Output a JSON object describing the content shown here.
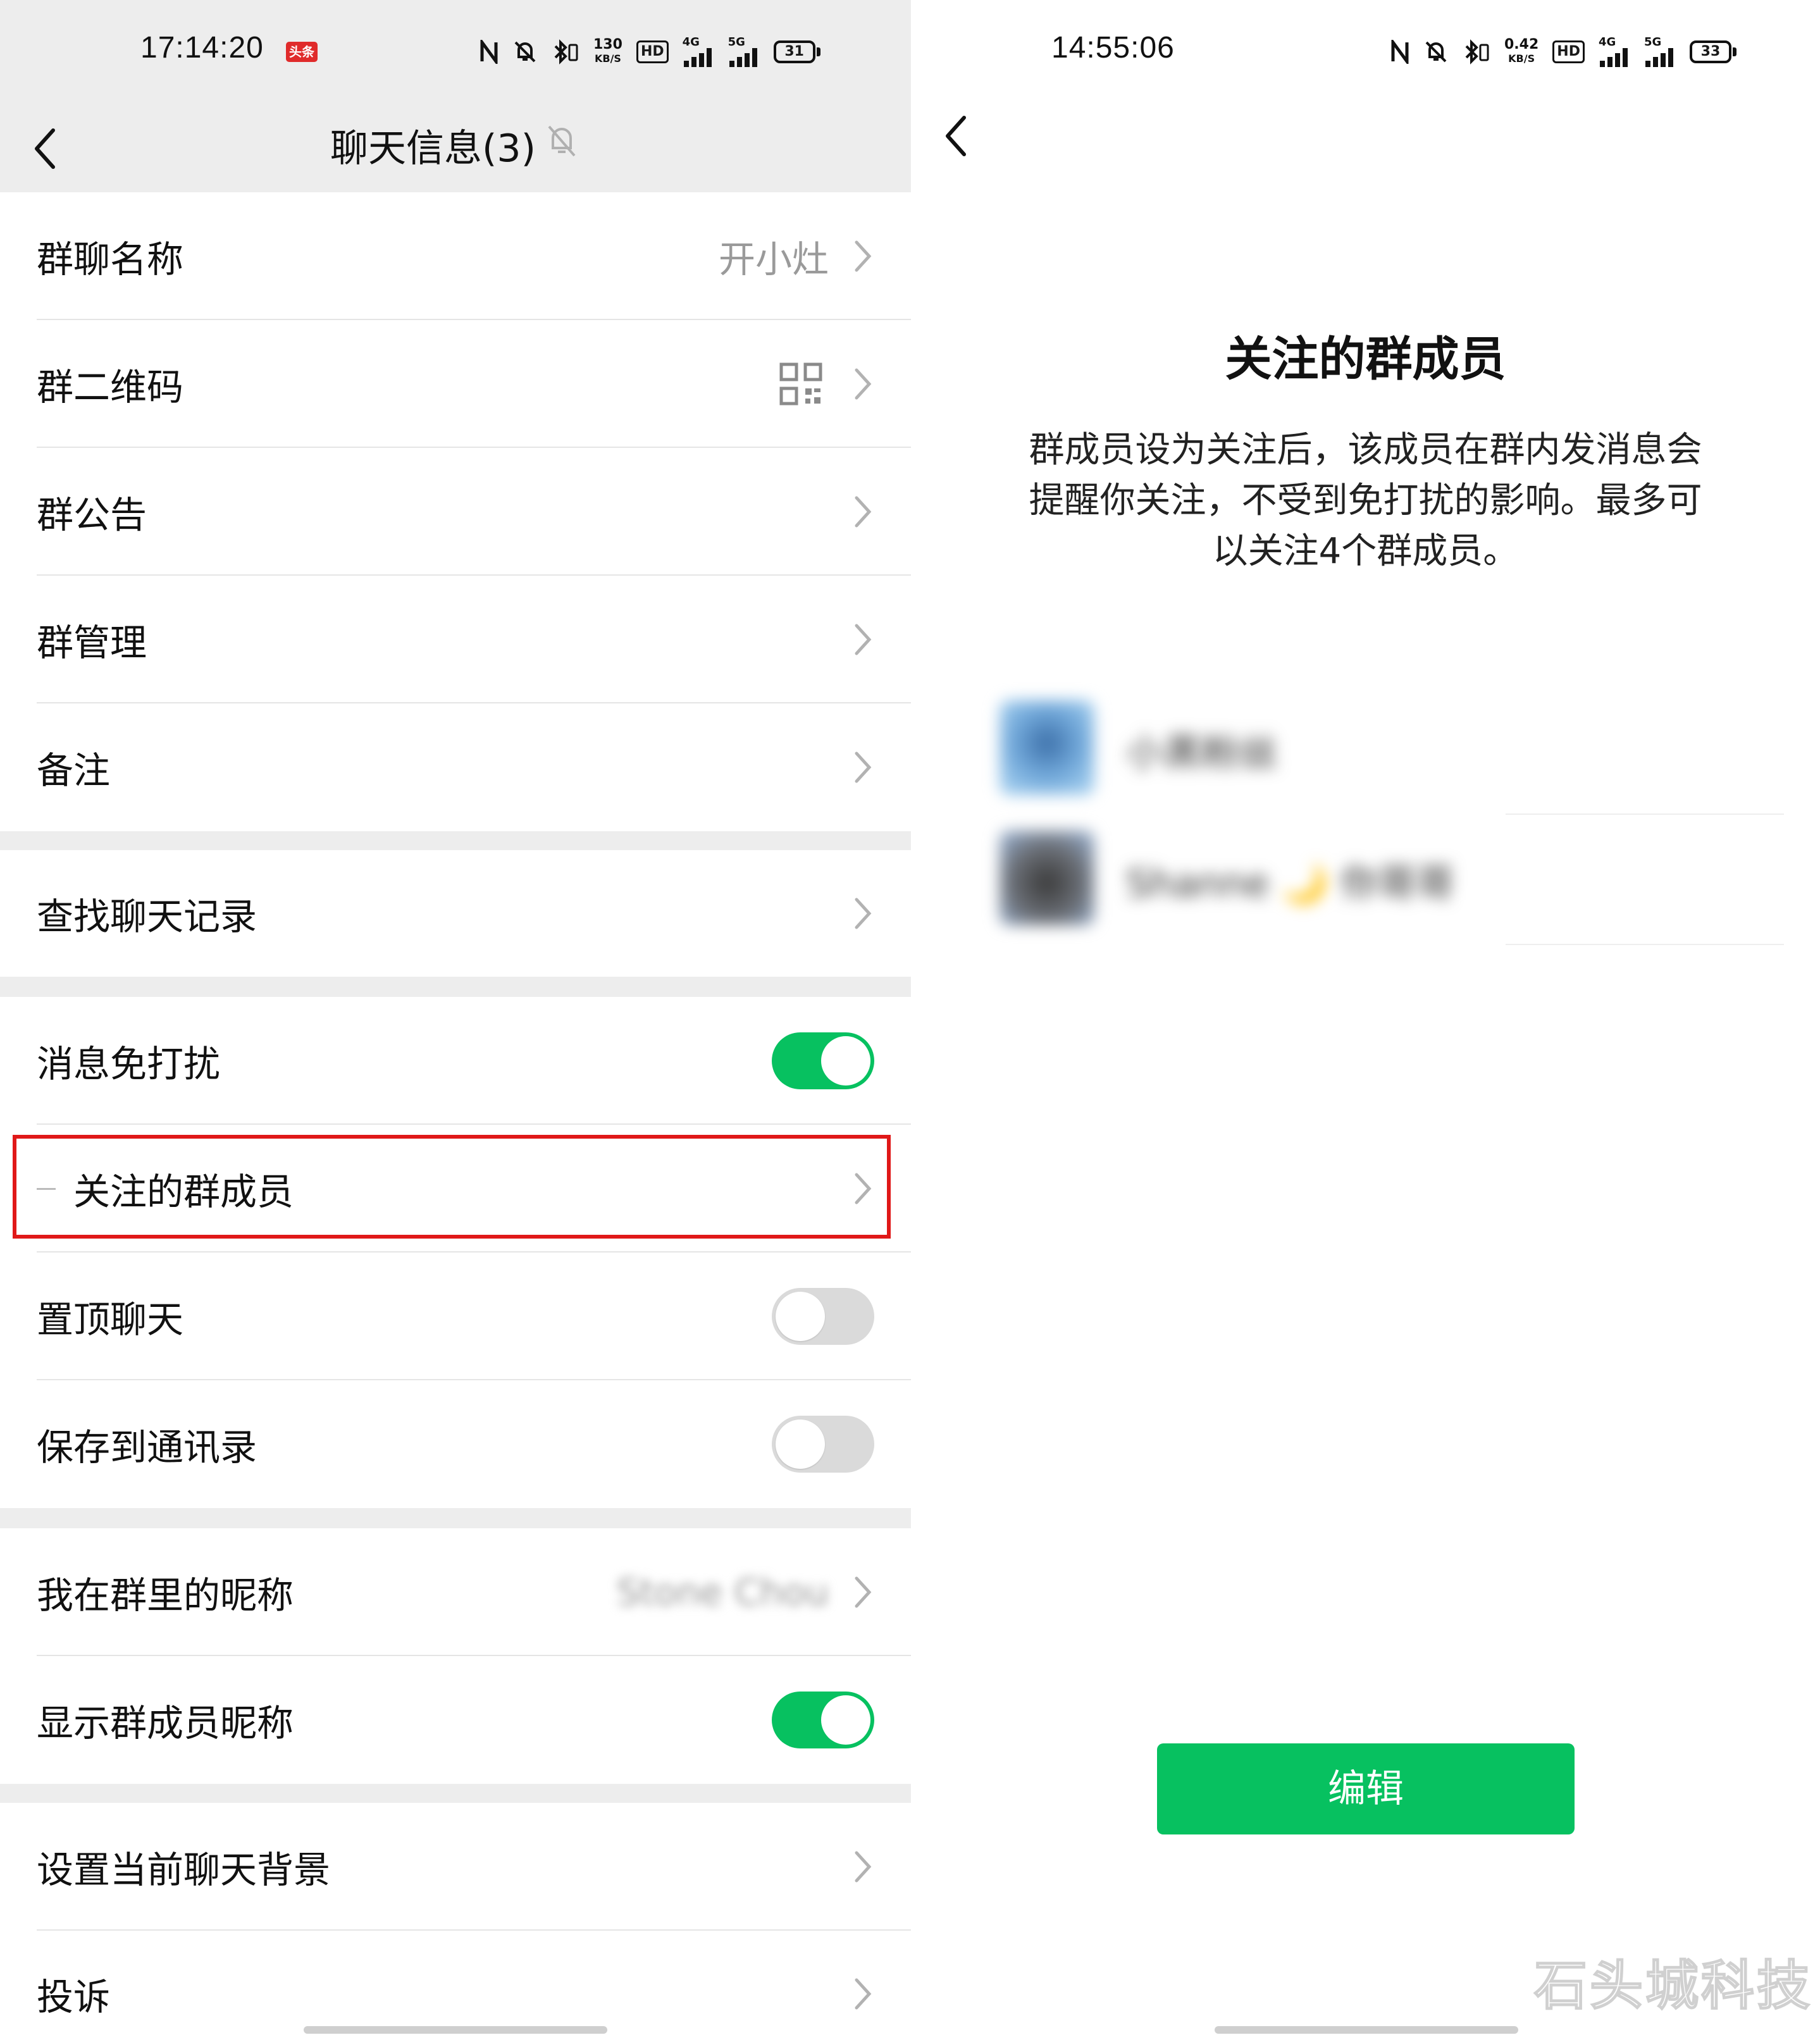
{
  "left": {
    "status_bar": {
      "time": "17:14:20",
      "app_badge": "头条",
      "network_speed_value": "130",
      "network_speed_unit": "KB/S",
      "hd_label": "HD",
      "signal_4g_label": "4G",
      "signal_5g_label": "5G",
      "battery": "31"
    },
    "nav": {
      "title": "聊天信息(3)"
    },
    "groups": [
      {
        "rows": [
          {
            "label": "群聊名称",
            "value": "开小灶"
          },
          {
            "label": "群二维码"
          },
          {
            "label": "群公告"
          },
          {
            "label": "群管理"
          },
          {
            "label": "备注"
          }
        ]
      },
      {
        "rows": [
          {
            "label": "查找聊天记录"
          }
        ]
      },
      {
        "rows": [
          {
            "label": "消息免打扰",
            "toggle": "on"
          },
          {
            "label": "关注的群成员",
            "highlighted": true
          },
          {
            "label": "置顶聊天",
            "toggle": "off"
          },
          {
            "label": "保存到通讯录",
            "toggle": "off"
          }
        ]
      },
      {
        "rows": [
          {
            "label": "我在群里的昵称",
            "value": "Stone Chou"
          },
          {
            "label": "显示群成员昵称",
            "toggle": "on"
          }
        ]
      },
      {
        "rows": [
          {
            "label": "设置当前聊天背景"
          },
          {
            "label": "投诉"
          }
        ]
      }
    ]
  },
  "right": {
    "status_bar": {
      "time": "14:55:06",
      "network_speed_value": "0.42",
      "network_speed_unit": "KB/S",
      "hd_label": "HD",
      "signal_4g_label": "4G",
      "signal_5g_label": "5G",
      "battery": "33"
    },
    "heading": "关注的群成员",
    "description_lines": [
      "群成员设为关注后，该成员在群内发消息会",
      "提醒你关注，不受到免打扰的影响。最多可",
      "以关注4个群成员。"
    ],
    "members": [
      {
        "name": "小黑粉丝"
      },
      {
        "name": "Shanne 🌙 你哥哥"
      }
    ],
    "edit_button": "编辑",
    "watermark": "石头城科技"
  },
  "colors": {
    "accent_green": "#07c160",
    "highlight_red": "#e01818",
    "page_gray": "#ededed"
  }
}
